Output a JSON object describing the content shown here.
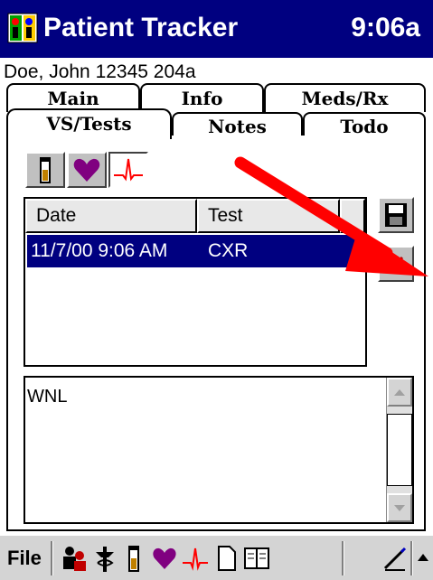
{
  "titlebar": {
    "app_title": "Patient Tracker",
    "clock": "9:06a",
    "app_icon": "patient-tracker-icon"
  },
  "patient": {
    "header": "Doe, John 12345 204a"
  },
  "tabs_back": [
    {
      "label": "Main"
    },
    {
      "label": "Info"
    },
    {
      "label": "Meds/Rx"
    }
  ],
  "tabs_front": [
    {
      "label": "VS/Tests",
      "active": true
    },
    {
      "label": "Notes"
    },
    {
      "label": "Todo"
    }
  ],
  "category_buttons": [
    {
      "icon": "test-tube-icon"
    },
    {
      "icon": "heart-icon"
    },
    {
      "icon": "ekg-icon",
      "selected": true
    }
  ],
  "list": {
    "columns": [
      "Date",
      "Test"
    ],
    "rows": [
      {
        "date": "11/7/00 9:06 AM",
        "test": "CXR"
      }
    ]
  },
  "side_buttons": [
    {
      "icon": "save-disk-icon"
    },
    {
      "icon": "delete-x-icon"
    }
  ],
  "notes": {
    "text": "WNL"
  },
  "bottom_bar": {
    "menu_label": "File",
    "icons": [
      "people-icon",
      "caduceus-icon",
      "test-tube-icon",
      "heart-icon",
      "ekg-icon",
      "document-icon",
      "book-icon",
      "pen-icon",
      "up-arrow-icon"
    ]
  },
  "colors": {
    "titlebar": "#000080",
    "selection": "#000080",
    "annotation_arrow": "#ff0000"
  }
}
